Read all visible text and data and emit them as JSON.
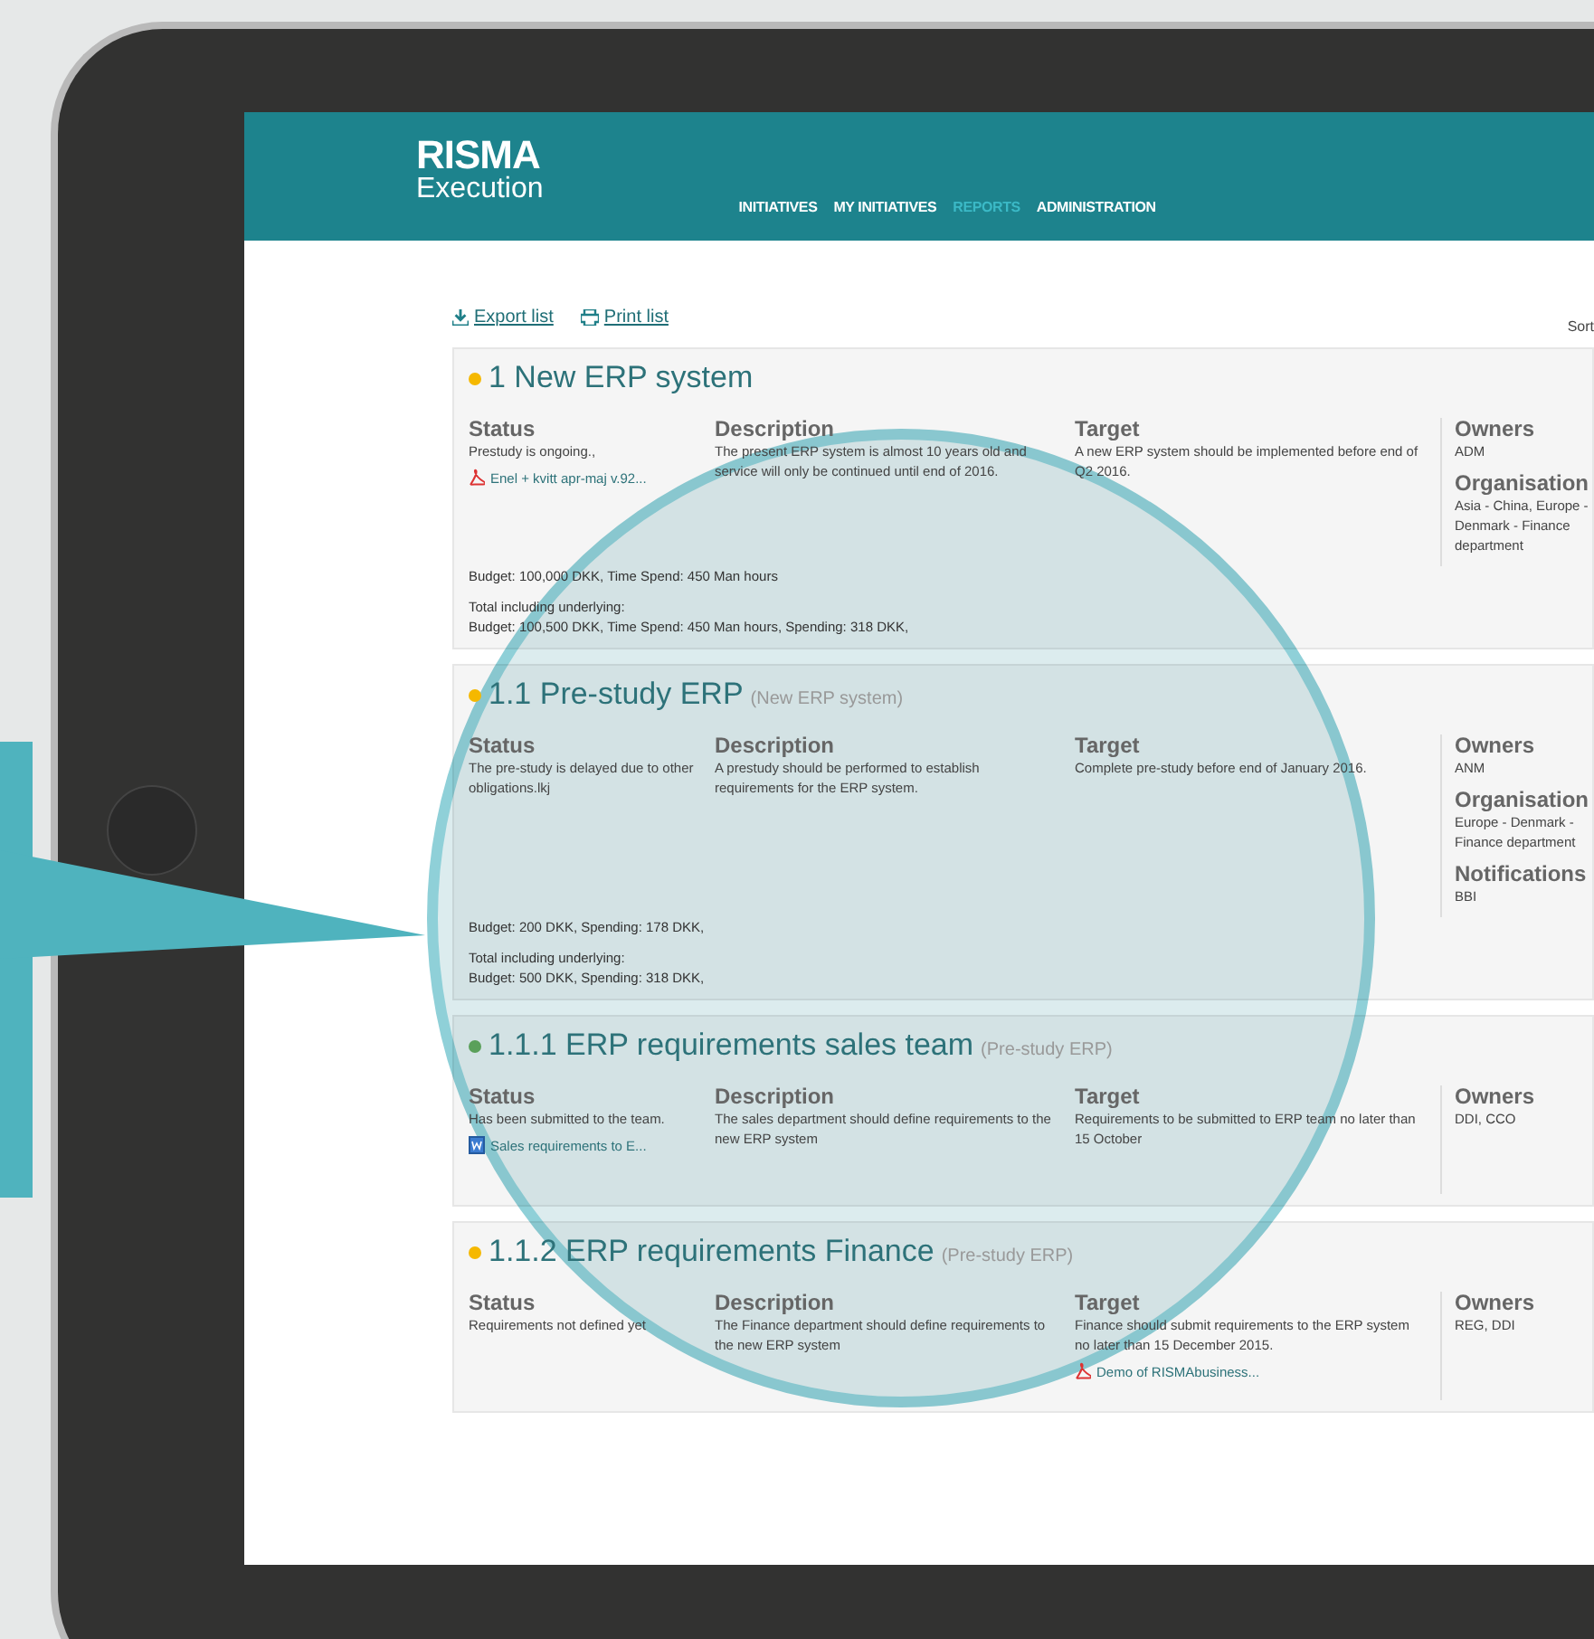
{
  "app": {
    "logo_title": "RISMA",
    "logo_subtitle": "Execution"
  },
  "nav": [
    {
      "label": "INITIATIVES",
      "selected": false
    },
    {
      "label": "MY INITIATIVES",
      "selected": false
    },
    {
      "label": "REPORTS",
      "selected": true
    },
    {
      "label": "ADMINISTRATION",
      "selected": false
    }
  ],
  "toolbar": {
    "export": "Export list",
    "print": "Print list",
    "sort": "Sort"
  },
  "initiatives": [
    {
      "title": "1 New ERP system",
      "color": "#f5b800",
      "columns": [
        {
          "heading": "Status",
          "text": "Prestudy is ongoing.,",
          "attachments": [
            {
              "kind": "pdf",
              "label": "Enel + kvitt apr-maj v.92..."
            }
          ]
        },
        {
          "heading": "Description",
          "text": "The present ERP system is almost 10 years old and service will only be continued until end of 2016."
        },
        {
          "heading": "Target",
          "text": "A new ERP system should be implemented before end of Q2 2016."
        }
      ],
      "side": [
        {
          "heading": "Owners",
          "text": "ADM"
        },
        {
          "heading": "Organisation",
          "text": "Asia - China, Europe - Denmark - Finance department"
        }
      ],
      "budget": "Budget: 100,000 DKK, Time Spend: 450 Man hours",
      "total_label": "Total including underlying:",
      "total": "Budget: 100,500 DKK, Time Spend: 450 Man hours, Spending: 318 DKK,"
    },
    {
      "title": "1.1 Pre-study ERP",
      "parent": "(New ERP system)",
      "color": "#f5b800",
      "columns": [
        {
          "heading": "Status",
          "text": "The pre-study is delayed due to other obligations.lkj"
        },
        {
          "heading": "Description",
          "text": "A prestudy should be performed to establish requirements for the ERP system."
        },
        {
          "heading": "Target",
          "text": "Complete pre-study before end of January 2016."
        }
      ],
      "side": [
        {
          "heading": "Owners",
          "text": "ANM"
        },
        {
          "heading": "Organisation",
          "text": "Europe - Denmark - Finance department"
        },
        {
          "heading": "Notifications",
          "text": "BBI"
        }
      ],
      "budget": "Budget: 200 DKK, Spending: 178 DKK,",
      "total_label": "Total including underlying:",
      "total": "Budget: 500 DKK, Spending: 318 DKK,"
    },
    {
      "title": "1.1.1 ERP requirements sales team",
      "parent": "(Pre-study ERP)",
      "color": "#5aa05a",
      "columns": [
        {
          "heading": "Status",
          "text": "Has been submitted to the team.",
          "attachments": [
            {
              "kind": "word",
              "label": "Sales requirements to E..."
            }
          ]
        },
        {
          "heading": "Description",
          "text": "The sales department should define requirements to the new ERP system"
        },
        {
          "heading": "Target",
          "text": "Requirements to be submitted to ERP team no later than 15 October"
        }
      ],
      "side": [
        {
          "heading": "Owners",
          "text": "DDI, CCO"
        }
      ]
    },
    {
      "title": "1.1.2 ERP requirements Finance",
      "parent": "(Pre-study ERP)",
      "color": "#f5b800",
      "columns": [
        {
          "heading": "Status",
          "text": "Requirements not defined yet"
        },
        {
          "heading": "Description",
          "text": "The Finance department should define requirements to the new ERP system"
        },
        {
          "heading": "Target",
          "text": "Finance should submit requirements to the ERP system no later than 15 December 2015.",
          "attachments": [
            {
              "kind": "pdf",
              "label": "Demo of RISMAbusiness..."
            }
          ]
        }
      ],
      "side": [
        {
          "heading": "Owners",
          "text": "REG, DDI"
        }
      ]
    }
  ]
}
